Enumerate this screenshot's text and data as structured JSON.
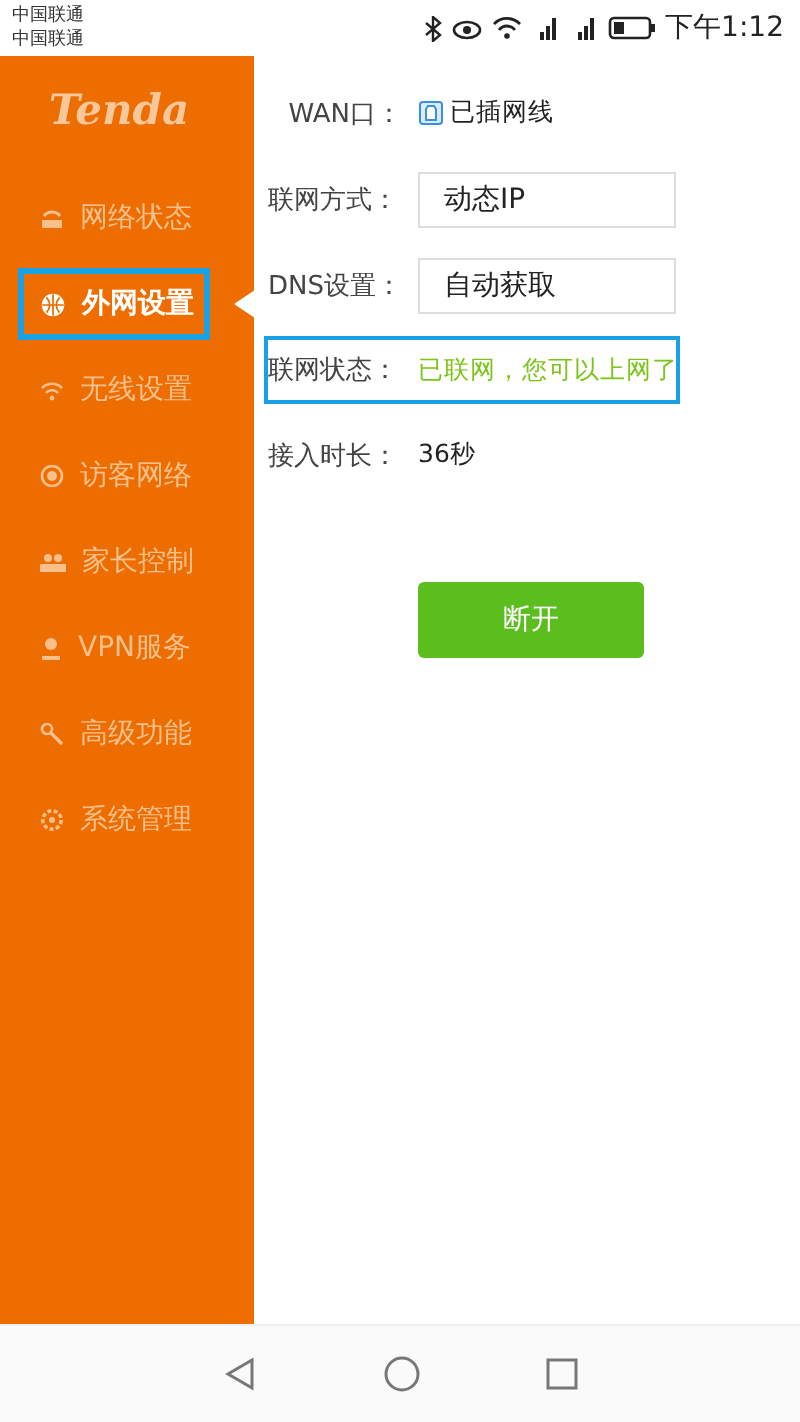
{
  "status_bar": {
    "carriers": [
      "中国联通",
      "中国联通"
    ],
    "time": "下午1:12"
  },
  "sidebar": {
    "logo": "Tenda",
    "items": [
      {
        "label": "网络状态",
        "selected": false
      },
      {
        "label": "外网设置",
        "selected": true
      },
      {
        "label": "无线设置",
        "selected": false
      },
      {
        "label": "访客网络",
        "selected": false
      },
      {
        "label": "家长控制",
        "selected": false
      },
      {
        "label": "VPN服务",
        "selected": false
      },
      {
        "label": "高级功能",
        "selected": false
      },
      {
        "label": "系统管理",
        "selected": false
      }
    ]
  },
  "form": {
    "rows": [
      {
        "kind": "port",
        "label": "WAN口：",
        "value": "已插网线",
        "highlighted": false
      },
      {
        "kind": "select",
        "label": "联网方式：",
        "value": "动态IP",
        "highlighted": false
      },
      {
        "kind": "select",
        "label": "DNS设置：",
        "value": "自动获取",
        "highlighted": false
      },
      {
        "kind": "status",
        "label": "联网状态：",
        "value": "已联网，您可以上网了",
        "highlighted": true
      },
      {
        "kind": "text",
        "label": "接入时长：",
        "value": "36秒",
        "highlighted": false
      }
    ],
    "button": "断开"
  }
}
